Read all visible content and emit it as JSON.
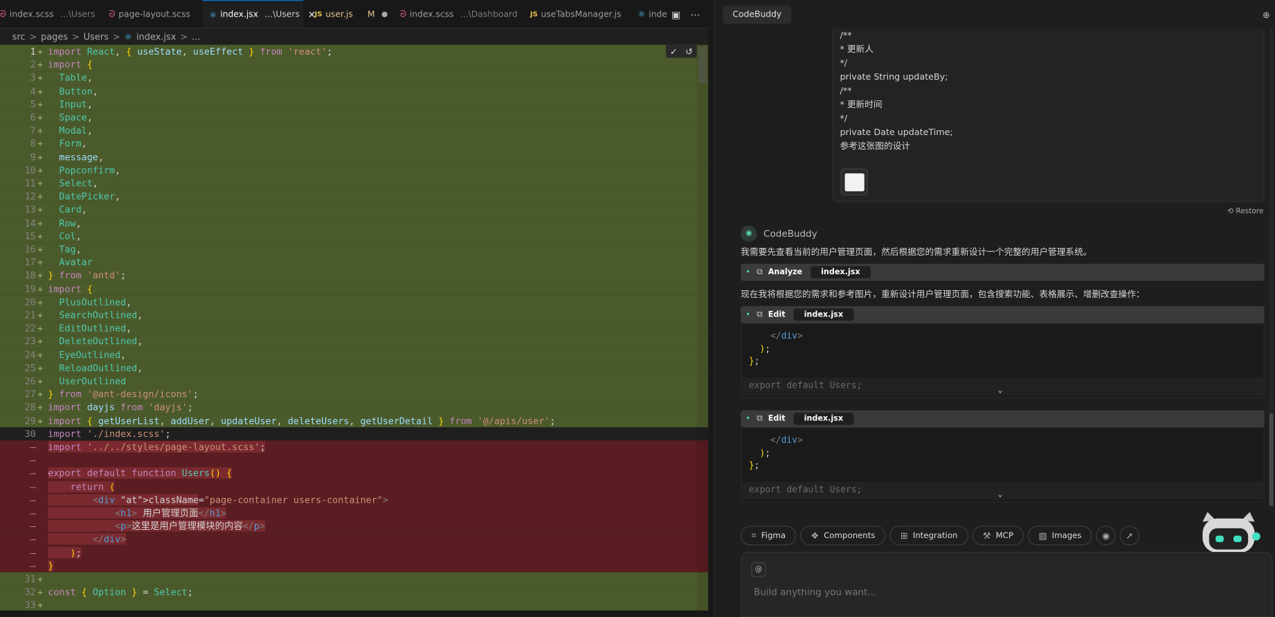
{
  "tabs": [
    {
      "label": "index.scss",
      "suffix": "...\\Users",
      "icon": "scss-icon"
    },
    {
      "label": "page-layout.scss",
      "suffix": "",
      "icon": "scss-icon"
    },
    {
      "label": "index.jsx",
      "suffix": "...\\Users",
      "icon": "react-icon",
      "active": true
    },
    {
      "label": "user.js",
      "suffix": "",
      "icon": "js-icon",
      "status": "M"
    },
    {
      "label": "index.scss",
      "suffix": "...\\Dashboard",
      "icon": "scss-icon"
    },
    {
      "label": "useTabsManager.js",
      "suffix": "",
      "icon": "js-icon"
    },
    {
      "label": "inde",
      "suffix": "",
      "icon": "react-icon"
    }
  ],
  "breadcrumb": [
    "src",
    "pages",
    "Users",
    "index.jsx",
    "..."
  ],
  "editor": {
    "added_top": [
      "import React, { useState, useEffect } from 'react';",
      "import {",
      "  Table,",
      "  Button,",
      "  Input,",
      "  Space,",
      "  Modal,",
      "  Form,",
      "  message,",
      "  Popconfirm,",
      "  Select,",
      "  DatePicker,",
      "  Card,",
      "  Row,",
      "  Col,",
      "  Tag,",
      "  Avatar",
      "} from 'antd';",
      "import {",
      "  PlusOutlined,",
      "  SearchOutlined,",
      "  EditOutlined,",
      "  DeleteOutlined,",
      "  EyeOutlined,",
      "  ReloadOutlined,",
      "  UserOutlined",
      "} from '@ant-design/icons';",
      "import dayjs from 'dayjs';",
      "import { getUserList, addUser, updateUser, deleteUsers, getUserDetail } from '@/apis/user';"
    ],
    "unchanged": "import './index.scss';",
    "deleted": [
      "import '../../styles/page-layout.scss';",
      "",
      "export default function Users() {",
      "    return (",
      "        <div className=\"page-container users-container\">",
      "            <h1> 用户管理页面</h1>",
      "            <p>这里是用户管理模块的内容</p>",
      "        </div>",
      "    );",
      "}"
    ],
    "added_bottom": [
      "",
      "const { Option } = Select;",
      ""
    ],
    "line_numbers_top_start": 1,
    "unchanged_number": "30",
    "bottom_start": 31
  },
  "panel": {
    "title": "CodeBuddy",
    "user_message": [
      "/**",
      "* 更新人",
      "*/",
      "private String updateBy;",
      "/**",
      "* 更新时间",
      "*/",
      "private Date updateTime;",
      "参考这张图的设计"
    ],
    "restore_label": "Restore",
    "bot_name": "CodeBuddy",
    "msg1": "我需要先查看当前的用户管理页面，然后根据您的需求重新设计一个完整的用户管理系统。",
    "tool1": {
      "action": "Analyze",
      "file": "index.jsx"
    },
    "msg2": "现在我将根据您的需求和参考图片，重新设计用户管理页面，包含搜索功能、表格展示、增删改查操作：",
    "tool2": {
      "action": "Edit",
      "file": "index.jsx"
    },
    "tool3": {
      "action": "Edit",
      "file": "index.jsx"
    },
    "snippet": [
      "    </div>",
      "  );",
      "};",
      "",
      "export default Users;"
    ],
    "pills": [
      "Figma",
      "Components",
      "Integration",
      "MCP",
      "Images"
    ],
    "at_label": "@",
    "input_placeholder": "Build anything you want..."
  },
  "colors": {
    "added": "#4b5a2a",
    "deleted": "#5a1d22",
    "accent": "#4dd4c0"
  }
}
